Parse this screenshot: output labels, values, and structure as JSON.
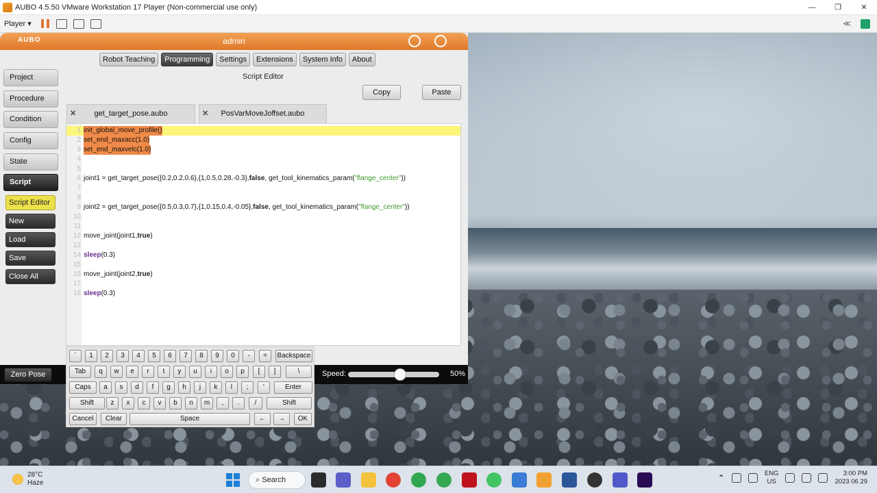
{
  "window": {
    "title": "AUBO 4.5.50    VMware Workstation 17 Player (Non-commercial use only)",
    "min": "—",
    "max": "❐",
    "close": "✕"
  },
  "vm_toolbar": {
    "player_label": "Player ▾",
    "collapse": "≪"
  },
  "app": {
    "brand": "AUBO",
    "user": "admin",
    "nav": [
      "Robot Teaching",
      "Programming",
      "Settings",
      "Extensions",
      "System Info",
      "About"
    ],
    "nav_active": "Programming",
    "editor_title": "Script Editor",
    "side": [
      "Project",
      "Procedure",
      "Condition",
      "Config",
      "State",
      "Script"
    ],
    "side_active": "Script",
    "sub": [
      "Script Editor",
      "New",
      "Load",
      "Save",
      "Close All"
    ],
    "copy_label": "Copy",
    "paste_label": "Paste",
    "tabs": [
      "get_target_pose.aubo",
      "PosVarMoveJoffset.aubo"
    ],
    "tab_close": "✕"
  },
  "code_lines": [
    {
      "n": "1",
      "t": "init_global_move_profile()"
    },
    {
      "n": "2",
      "t": "set_end_maxacc(1.0)"
    },
    {
      "n": "3",
      "t": "set_end_maxvelc(1.0)"
    },
    {
      "n": "4",
      "t": ""
    },
    {
      "n": "5",
      "t": ""
    },
    {
      "n": "6",
      "t": "joint1 = get_target_pose({0.2,0.2,0.6},{1,0.5,0.28,-0.3},false, get_tool_kinematics_param(\"flange_center\"))"
    },
    {
      "n": "7",
      "t": ""
    },
    {
      "n": "8",
      "t": ""
    },
    {
      "n": "9",
      "t": "joint2 = get_target_pose({0.5,0.3,0.7},{1,0.15,0.4,-0.05},false, get_tool_kinematics_param(\"flange_center\"))"
    },
    {
      "n": "10",
      "t": ""
    },
    {
      "n": "11",
      "t": ""
    },
    {
      "n": "12",
      "t": "move_joint(joint1,true)"
    },
    {
      "n": "13",
      "t": ""
    },
    {
      "n": "14",
      "t": "sleep(0.3)"
    },
    {
      "n": "15",
      "t": ""
    },
    {
      "n": "16",
      "t": "move_joint(joint2,true)"
    },
    {
      "n": "17",
      "t": ""
    },
    {
      "n": "18",
      "t": "sleep(0.3)"
    }
  ],
  "keyboard": {
    "row1": [
      "`",
      "1",
      "2",
      "3",
      "4",
      "5",
      "6",
      "7",
      "8",
      "9",
      "0",
      "-",
      "=",
      "Backspace"
    ],
    "row2": [
      "Tab",
      "q",
      "w",
      "e",
      "r",
      "t",
      "y",
      "u",
      "i",
      "o",
      "p",
      "[",
      "]",
      "\\"
    ],
    "row3": [
      "Caps",
      "a",
      "s",
      "d",
      "f",
      "g",
      "h",
      "j",
      "k",
      "l",
      ";",
      "'",
      "Enter"
    ],
    "row4": [
      "Shift",
      "z",
      "x",
      "c",
      "v",
      "b",
      "n",
      "m",
      ",",
      ".",
      "/",
      "Shift"
    ],
    "row5": [
      "Cancel",
      "Clear",
      "Space",
      "←",
      "→",
      "OK"
    ]
  },
  "bottom": {
    "zero_pose": "Zero Pose",
    "speed_label": "Speed:",
    "speed_value": "50%",
    "speed": 0.5
  },
  "taskbar": {
    "temp": "28°C",
    "weather": "Haze",
    "search": "Search",
    "lang1": "ENG",
    "lang2": "US",
    "time": "3:00 PM",
    "date": "2023 06 29"
  }
}
